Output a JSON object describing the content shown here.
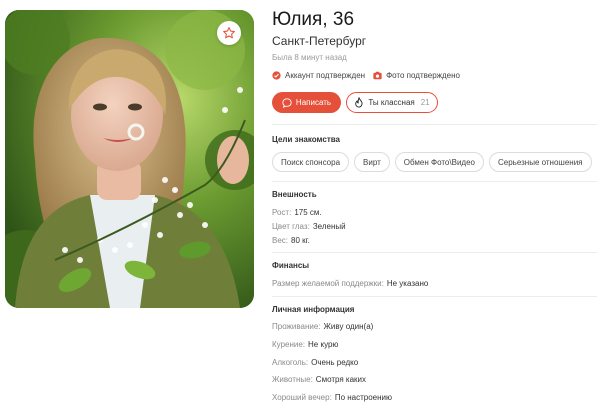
{
  "profile": {
    "name_age": "Юлия, 36",
    "city": "Санкт-Петербург",
    "last_seen": "Была 8 минут назад",
    "account_verified": "Аккаунт подтвержден",
    "photo_verified": "Фото подтверждено"
  },
  "actions": {
    "write_label": "Написать",
    "like_label": "Ты классная",
    "like_count": "21"
  },
  "goals": {
    "title": "Цели знакомства",
    "items": [
      "Поиск спонсора",
      "Вирт",
      "Обмен Фото\\Видео",
      "Серьезные отношения"
    ]
  },
  "appearance": {
    "title": "Внешность",
    "rows": [
      {
        "key": "Рост:",
        "value": "175 см."
      },
      {
        "key": "Цвет глаз:",
        "value": "Зеленый"
      },
      {
        "key": "Вес:",
        "value": "80 кг."
      }
    ]
  },
  "finance": {
    "title": "Финансы",
    "rows": [
      {
        "key": "Размер желаемой поддержки:",
        "value": "Не указано"
      }
    ]
  },
  "personal": {
    "title": "Личная информация",
    "rows": [
      {
        "key": "Проживание:",
        "value": "Живу один(а)"
      },
      {
        "key": "Курение:",
        "value": "Не курю"
      },
      {
        "key": "Алкоголь:",
        "value": "Очень редко"
      },
      {
        "key": "Животные:",
        "value": "Смотря каких"
      },
      {
        "key": "Хороший вечер:",
        "value": "По настроению"
      }
    ]
  },
  "colors": {
    "accent": "#e4503a",
    "muted": "#8a8a8a"
  },
  "icons": {
    "favorite": "star-icon",
    "account": "check-badge-icon",
    "photo": "camera-icon",
    "write": "chat-icon",
    "like": "flame-icon"
  }
}
